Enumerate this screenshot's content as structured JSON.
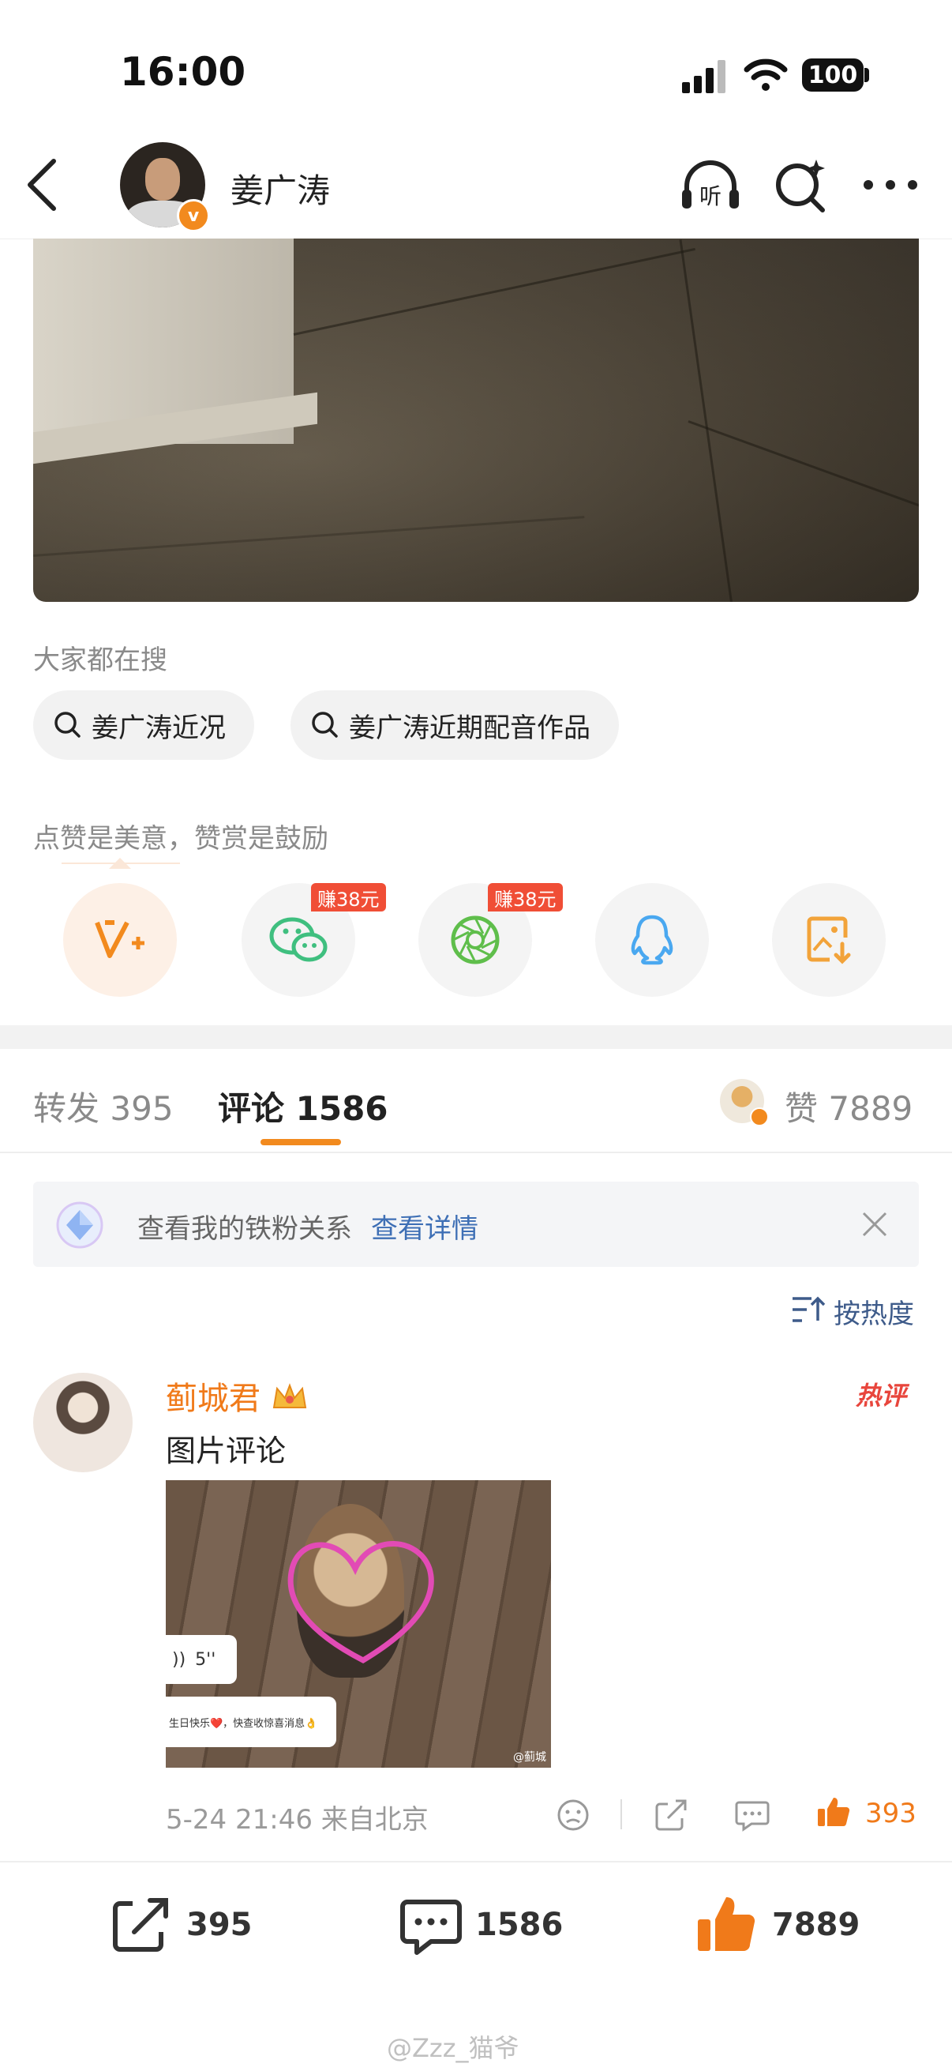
{
  "status_bar": {
    "time": "16:00",
    "battery": "100"
  },
  "nav": {
    "title": "姜广涛"
  },
  "search_section": {
    "label": "大家都在搜",
    "chips": [
      "姜广涛近况",
      "姜广涛近期配音作品"
    ]
  },
  "reward_section": {
    "label": "点赞是美意，赞赏是鼓励",
    "earn_badge": "赚38元"
  },
  "tabs": {
    "repost_label": "转发",
    "repost_count": "395",
    "comment_label": "评论",
    "comment_count": "1586",
    "like_label": "赞",
    "like_count": "7889"
  },
  "fans_bar": {
    "text": "查看我的铁粉关系",
    "link": "查看详情"
  },
  "sort": {
    "label": "按热度"
  },
  "comment": {
    "username": "蓟城君",
    "hot_badge": "热评",
    "text": "图片评论",
    "image_voice": "5''",
    "image_caption": "生日快乐❤️，快查收惊喜消息👌",
    "image_watermark": "@蓟城",
    "meta": "5-24 21:46 来自北京",
    "like_count": "393"
  },
  "bottom_bar": {
    "repost": "395",
    "comment": "1586",
    "like": "7889"
  },
  "watermark": "@Zzz_猫爷",
  "colors": {
    "accent": "#f28a1e",
    "link": "#3e5b8a",
    "hot": "#e8453c"
  }
}
